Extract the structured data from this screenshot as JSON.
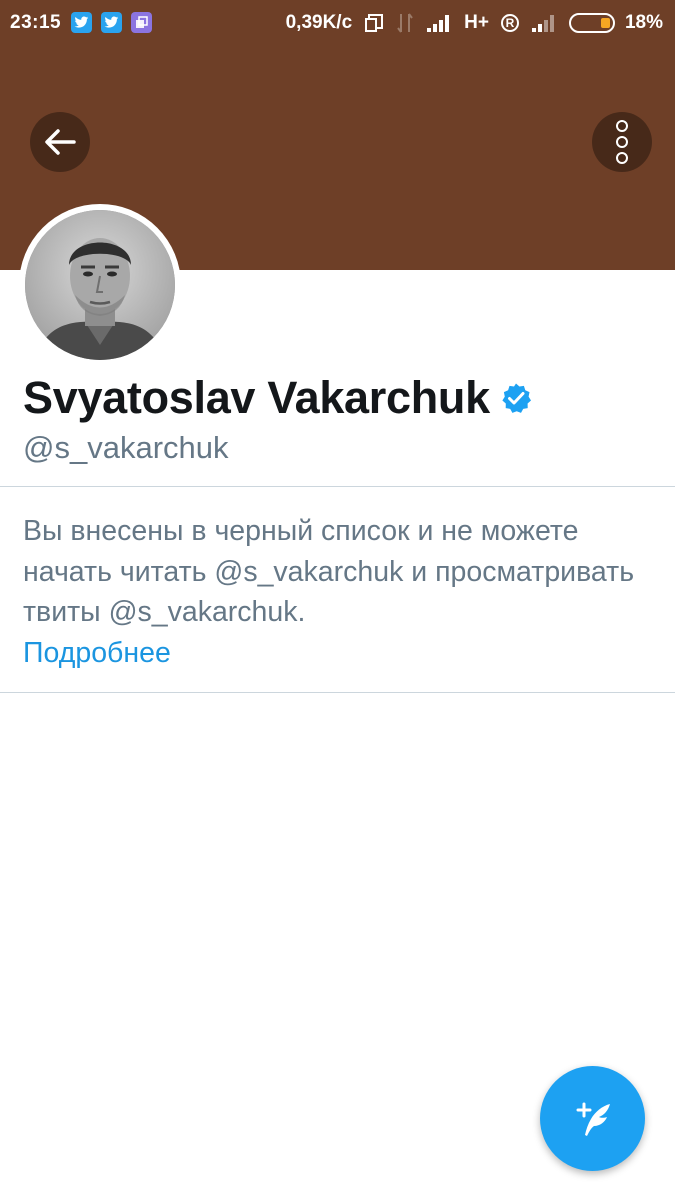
{
  "status_bar": {
    "time": "23:15",
    "net_speed": "0,39K/c",
    "network_type": "H+",
    "roaming_badge": "R",
    "battery_percent": "18%",
    "battery_level": 0.18,
    "notification_icons": [
      "twitter-icon",
      "twitter-icon",
      "notes-app-icon"
    ]
  },
  "header": {
    "banner_color": "#6e3f27",
    "back_icon": "arrow-left-icon",
    "menu_icon": "vertical-dots-icon"
  },
  "profile": {
    "display_name": "Svyatoslav Vakarchuk",
    "verified": true,
    "handle": "@s_vakarchuk"
  },
  "blocked_notice": {
    "message": "Вы внесены в черный список и не можете начать читать @s_vakarchuk и просматривать твиты @s_vakarchuk.",
    "link_text": "Подробнее"
  },
  "fab": {
    "icon": "compose-tweet-icon"
  },
  "colors": {
    "accent": "#1da1f2",
    "link": "#1b95e0",
    "muted_text": "#657786",
    "primary_text": "#14171a"
  }
}
